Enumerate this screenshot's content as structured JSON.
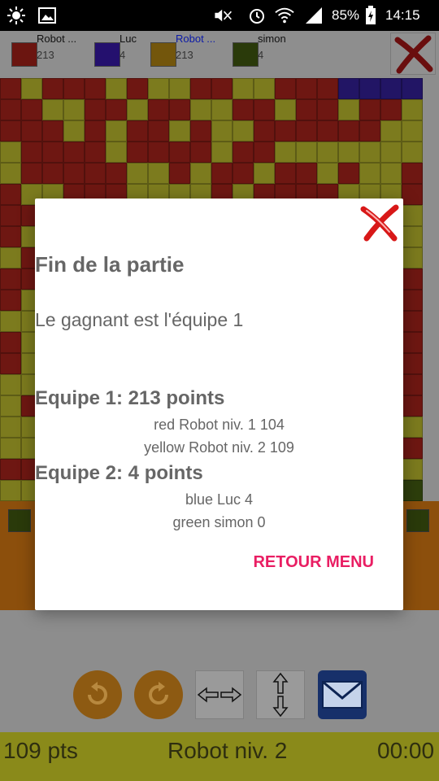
{
  "status_bar": {
    "battery_percent": "85%",
    "time": "14:15",
    "icons": [
      "brightness-icon",
      "image-icon",
      "mute-icon",
      "alarm-icon",
      "wifi-icon",
      "signal-icon",
      "battery-charging-icon"
    ]
  },
  "players": [
    {
      "name": "Robot ...",
      "score": "213",
      "color": "#6b1510",
      "name_color": "#111111"
    },
    {
      "name": "Luc",
      "score": "4",
      "color": "#24106e",
      "name_color": "#111111"
    },
    {
      "name": "Robot ...",
      "score": "213",
      "color": "#73560c",
      "name_color": "#0b1aa8"
    },
    {
      "name": "simon",
      "score": "4",
      "color": "#2a3a0a",
      "name_color": "#111111"
    }
  ],
  "colors": {
    "red": "#6e1712",
    "yellow": "#7c7b1e",
    "blue": "#221565",
    "green": "#2d3e0c",
    "accent": "#e91e63"
  },
  "dialog": {
    "title": "Fin de la partie",
    "winner_text": "Le gagnant est l'équipe 1",
    "team1_header": "Equipe 1: 213 points",
    "team1_lines": [
      "red Robot niv. 1 104",
      "yellow Robot niv. 2 109"
    ],
    "team2_header": "Equipe 2: 4 points",
    "team2_lines": [
      "blue Luc 4",
      "green simon 0"
    ],
    "action_label": "RETOUR MENU"
  },
  "footer": {
    "points": "109 pts",
    "player": "Robot niv. 2",
    "timer": "00:00"
  }
}
